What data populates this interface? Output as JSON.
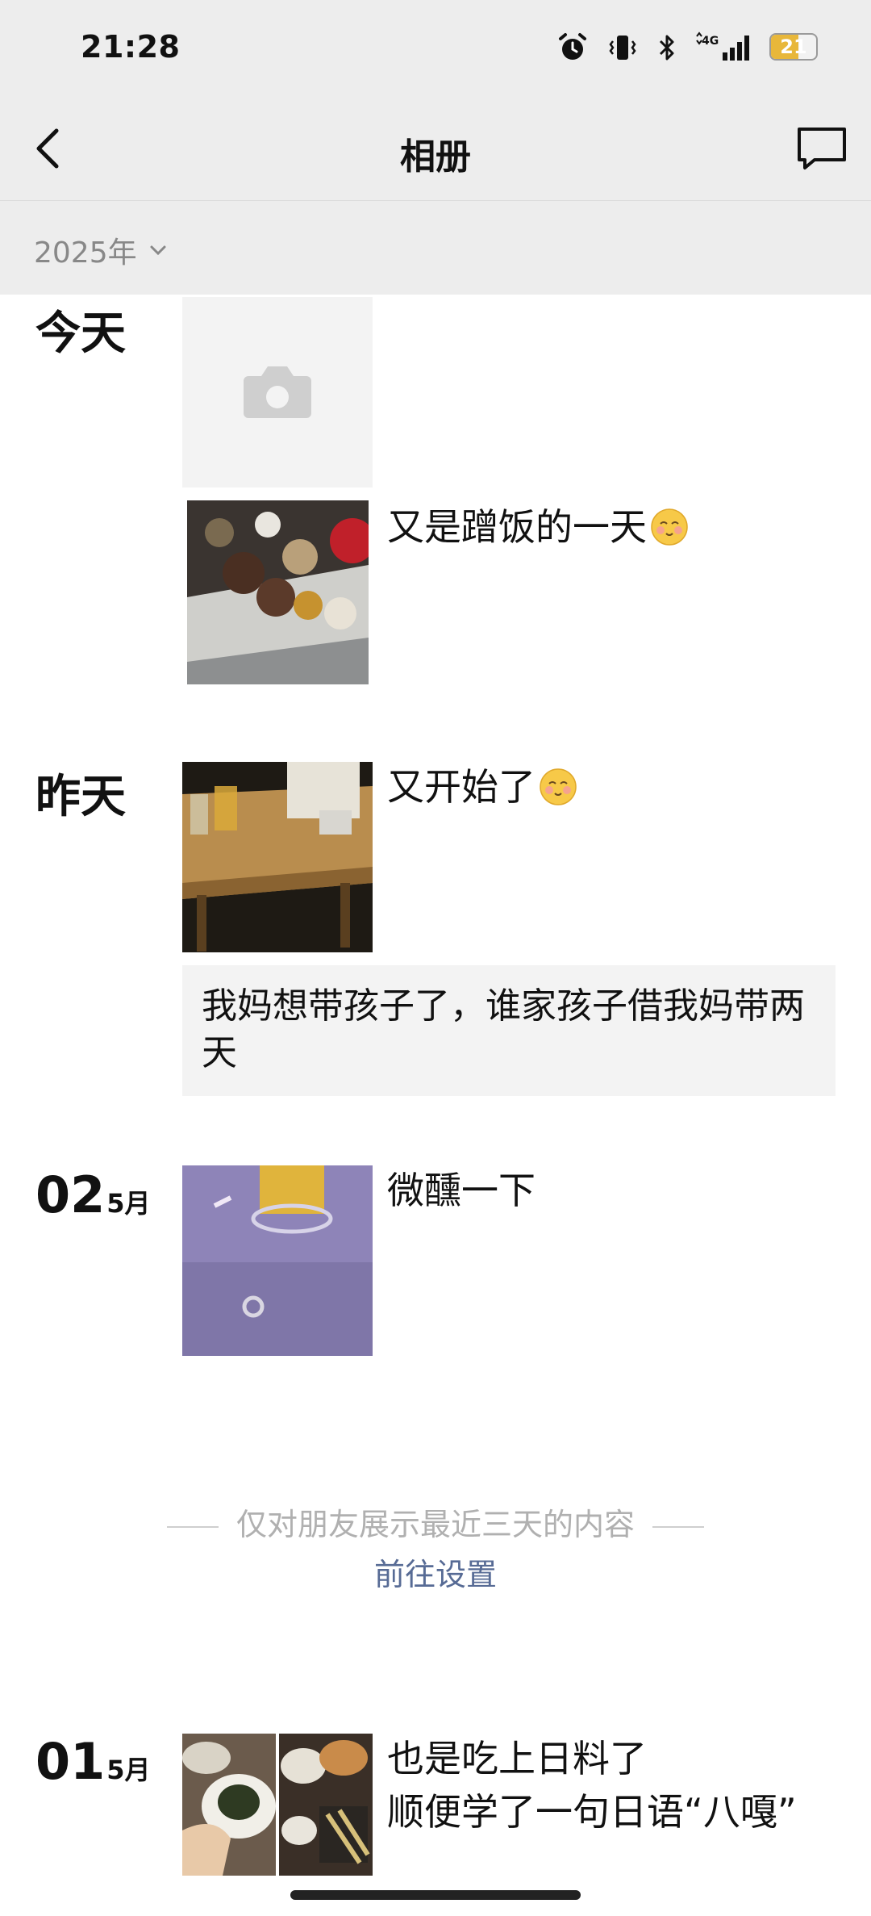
{
  "status_bar": {
    "time": "21:28",
    "battery": "21"
  },
  "nav": {
    "title": "相册"
  },
  "filter": {
    "year": "2025年"
  },
  "feed": [
    {
      "date": "今天",
      "posts": [
        {
          "type": "camera-placeholder"
        },
        {
          "type": "photo",
          "caption": "又是蹭饭的一天",
          "emoji": "smiling-face-emoji"
        }
      ]
    },
    {
      "date": "昨天",
      "posts": [
        {
          "type": "photo",
          "caption": "又开始了",
          "emoji": "smiling-face-emoji"
        },
        {
          "type": "text",
          "text": "我妈想带孩子了，谁家孩子借我妈带两天"
        }
      ]
    },
    {
      "day": "02",
      "month": "5月",
      "posts": [
        {
          "type": "photo",
          "caption": "微醺一下"
        }
      ]
    },
    {
      "day": "01",
      "month": "5月",
      "posts": [
        {
          "type": "photo-pair",
          "caption_line1": "也是吃上日料了",
          "caption_line2": "顺便学了一句日语“八嘎”"
        }
      ]
    }
  ],
  "visibility_notice": {
    "text": "仅对朋友展示最近三天的内容",
    "link": "前往设置"
  },
  "colors": {
    "link": "#576b95",
    "header_bg": "#ededed",
    "battery": "#e8b73a"
  }
}
